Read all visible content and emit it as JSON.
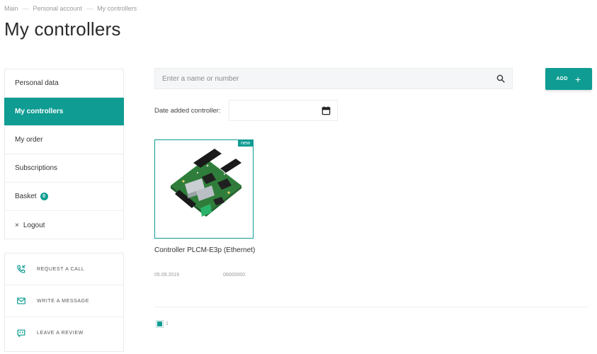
{
  "breadcrumb": {
    "items": [
      "Main",
      "Personal account",
      "My controllers"
    ],
    "separator": "—"
  },
  "page_title": "My controllers",
  "sidebar": {
    "items": [
      {
        "label": "Personal data",
        "active": false
      },
      {
        "label": "My controllers",
        "active": true
      },
      {
        "label": "My order",
        "active": false
      },
      {
        "label": "Subscriptions",
        "active": false
      },
      {
        "label": "Basket",
        "active": false,
        "badge": "0"
      },
      {
        "label": "Logout",
        "active": false,
        "icon": "close-icon",
        "icon_glyph": "×"
      }
    ]
  },
  "contacts": {
    "items": [
      {
        "label": "REQUEST A CALL",
        "icon": "phone-icon"
      },
      {
        "label": "WRITE A MESSAGE",
        "icon": "envelope-icon"
      },
      {
        "label": "LEAVE A REVIEW",
        "icon": "chat-icon"
      }
    ]
  },
  "search": {
    "placeholder": "Enter a name or number",
    "value": "",
    "icon": "search-icon"
  },
  "add_button": {
    "label": "ADD",
    "icon": "plus-icon",
    "icon_glyph": "+"
  },
  "date_filter": {
    "label": "Date added controller:",
    "value": "",
    "icon": "calendar-icon"
  },
  "products": [
    {
      "name": "Controller PLCM-E3p (Ethernet)",
      "badge": "new",
      "date": "05.09.2019",
      "number": "06000000",
      "image": "controller-board-image"
    }
  ],
  "pagination": {
    "current_page": "1"
  },
  "colors": {
    "accent": "#0f9c92",
    "text": "#333333",
    "muted": "#999999",
    "border": "#ececec",
    "board_green": "#2f7d3a"
  }
}
